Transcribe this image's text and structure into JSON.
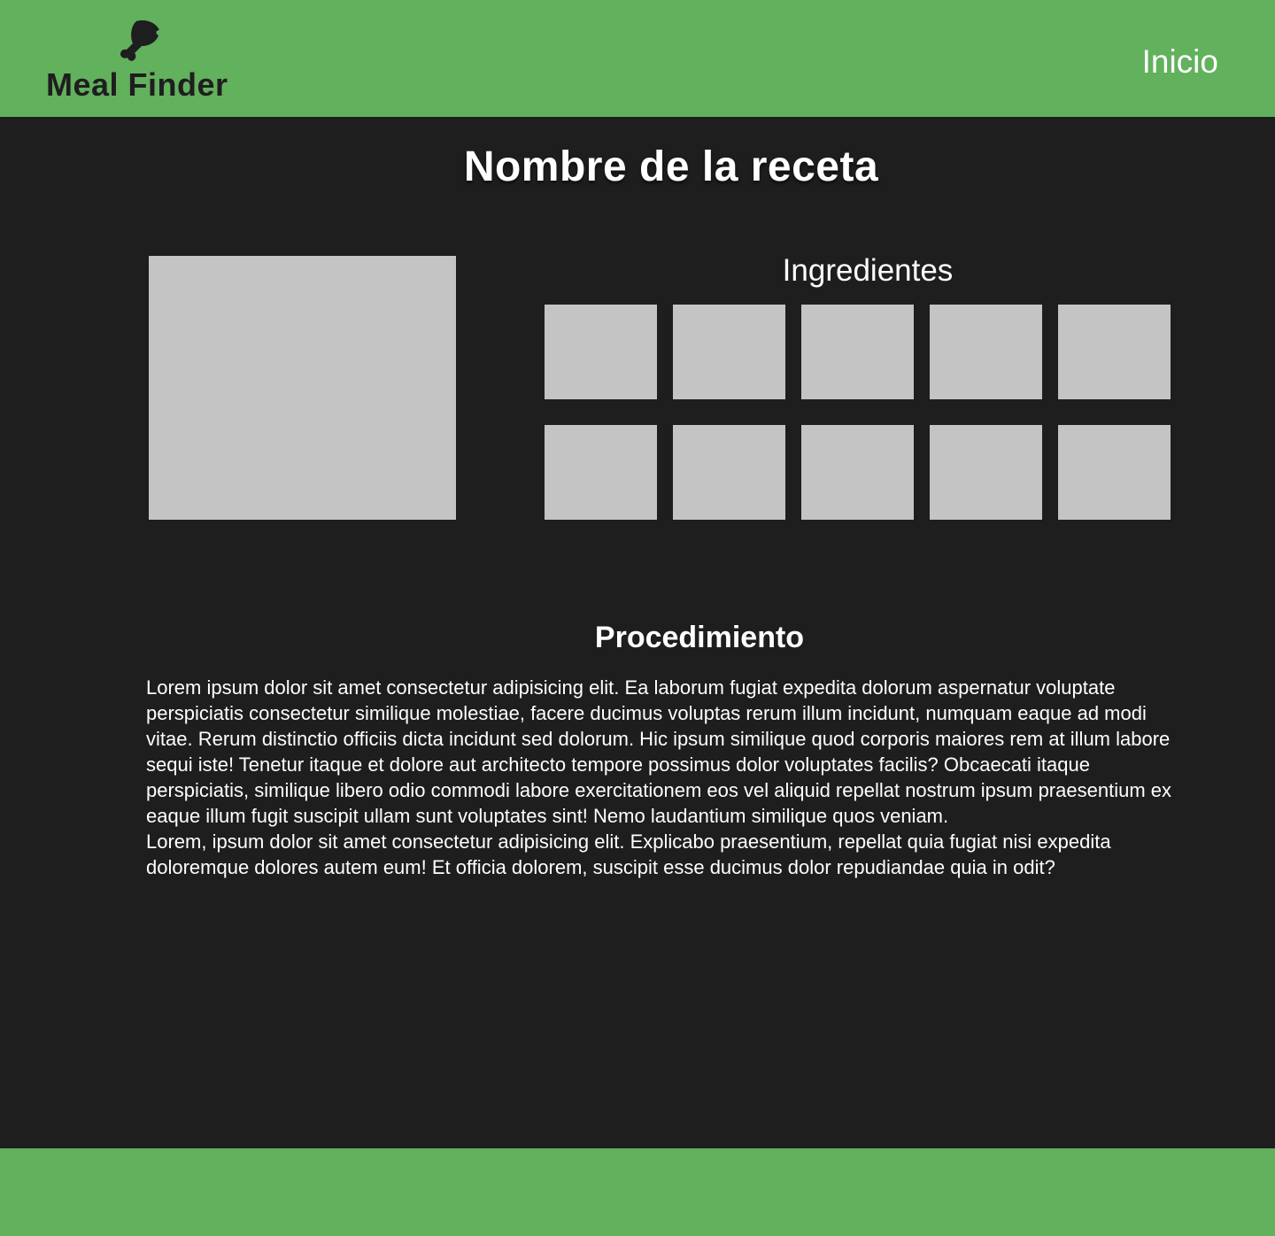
{
  "header": {
    "logo_icon": "chicken-drumstick-icon",
    "logo_text": "Meal Finder",
    "nav_link": "Inicio"
  },
  "recipe": {
    "title": "Nombre de la receta",
    "ingredients_title": "Ingredientes",
    "procedure_title": "Procedimiento",
    "procedure_paragraphs": [
      "Lorem ipsum dolor sit amet consectetur adipisicing elit. Ea laborum fugiat expedita dolorum aspernatur voluptate perspiciatis consectetur similique molestiae, facere ducimus voluptas rerum illum incidunt, numquam eaque ad modi vitae. Rerum distinctio officiis dicta incidunt sed dolorum. Hic ipsum similique quod corporis maiores rem at illum labore sequi iste! Tenetur itaque et dolore aut architecto tempore possimus dolor voluptates facilis? Obcaecati itaque perspiciatis, similique libero odio commodi labore exercitationem eos vel aliquid repellat nostrum ipsum praesentium ex eaque illum fugit suscipit ullam sunt voluptates sint! Nemo laudantium similique quos veniam.",
      "Lorem, ipsum dolor sit amet consectetur adipisicing elit. Explicabo praesentium, repellat quia fugiat nisi expedita doloremque dolores autem eum! Et officia dolorem, suscipit esse ducimus dolor repudiandae quia in odit?"
    ]
  },
  "colors": {
    "brand_green": "#62b15d",
    "background": "#1f1e1f",
    "placeholder_gray": "#c4c4c4",
    "text": "#ffffff"
  }
}
